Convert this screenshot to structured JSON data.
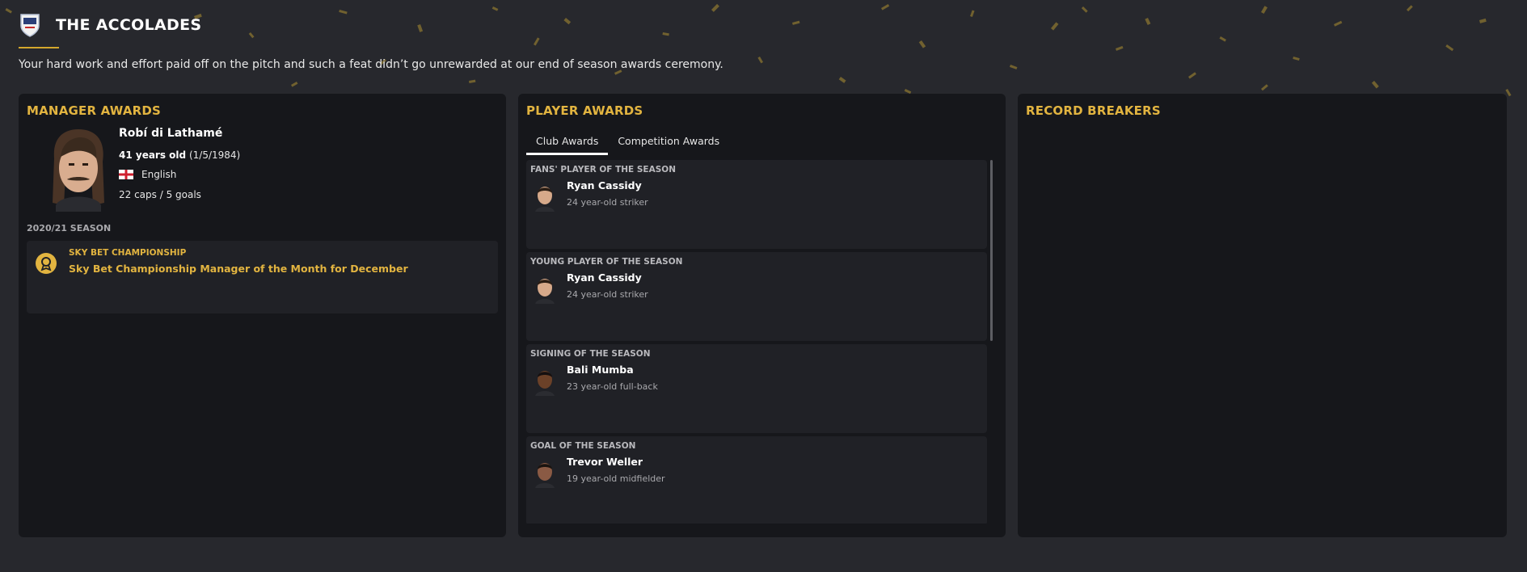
{
  "header": {
    "title": "THE ACCOLADES",
    "subtitle": "Your hard work and effort paid off on the pitch and such a feat didn’t go unrewarded at our end of season awards ceremony."
  },
  "manager_awards": {
    "title": "MANAGER AWARDS",
    "manager": {
      "name": "Robí di Lathamé",
      "age": "41 years old",
      "dob": "(1/5/1984)",
      "nationality": "English",
      "caps": "22 caps / 5 goals"
    },
    "season": "2020/21 SEASON",
    "awards": [
      {
        "competition": "SKY BET CHAMPIONSHIP",
        "name": "Sky Bet Championship Manager of the Month for December"
      }
    ]
  },
  "player_awards": {
    "title": "PLAYER AWARDS",
    "tabs": [
      {
        "label": "Club Awards",
        "active": true
      },
      {
        "label": "Competition Awards",
        "active": false
      }
    ],
    "awards": [
      {
        "category": "FANS' PLAYER OF THE SEASON",
        "player": "Ryan Cassidy",
        "description": "24 year-old striker",
        "skin": "#d6a98a",
        "hair": "#2a1d14"
      },
      {
        "category": "YOUNG PLAYER OF THE SEASON",
        "player": "Ryan Cassidy",
        "description": "24 year-old striker",
        "skin": "#d6a98a",
        "hair": "#2a1d14"
      },
      {
        "category": "SIGNING OF THE SEASON",
        "player": "Bali Mumba",
        "description": "23 year-old full-back",
        "skin": "#6b4128",
        "hair": "#151010"
      },
      {
        "category": "GOAL OF THE SEASON",
        "player": "Trevor Weller",
        "description": "19 year-old midfielder",
        "skin": "#8a5a44",
        "hair": "#1a1410"
      }
    ]
  },
  "record_breakers": {
    "title": "RECORD BREAKERS"
  },
  "colors": {
    "accent": "#e2b440",
    "background": "#27282d",
    "panel": "#16171b",
    "card": "#202126"
  }
}
